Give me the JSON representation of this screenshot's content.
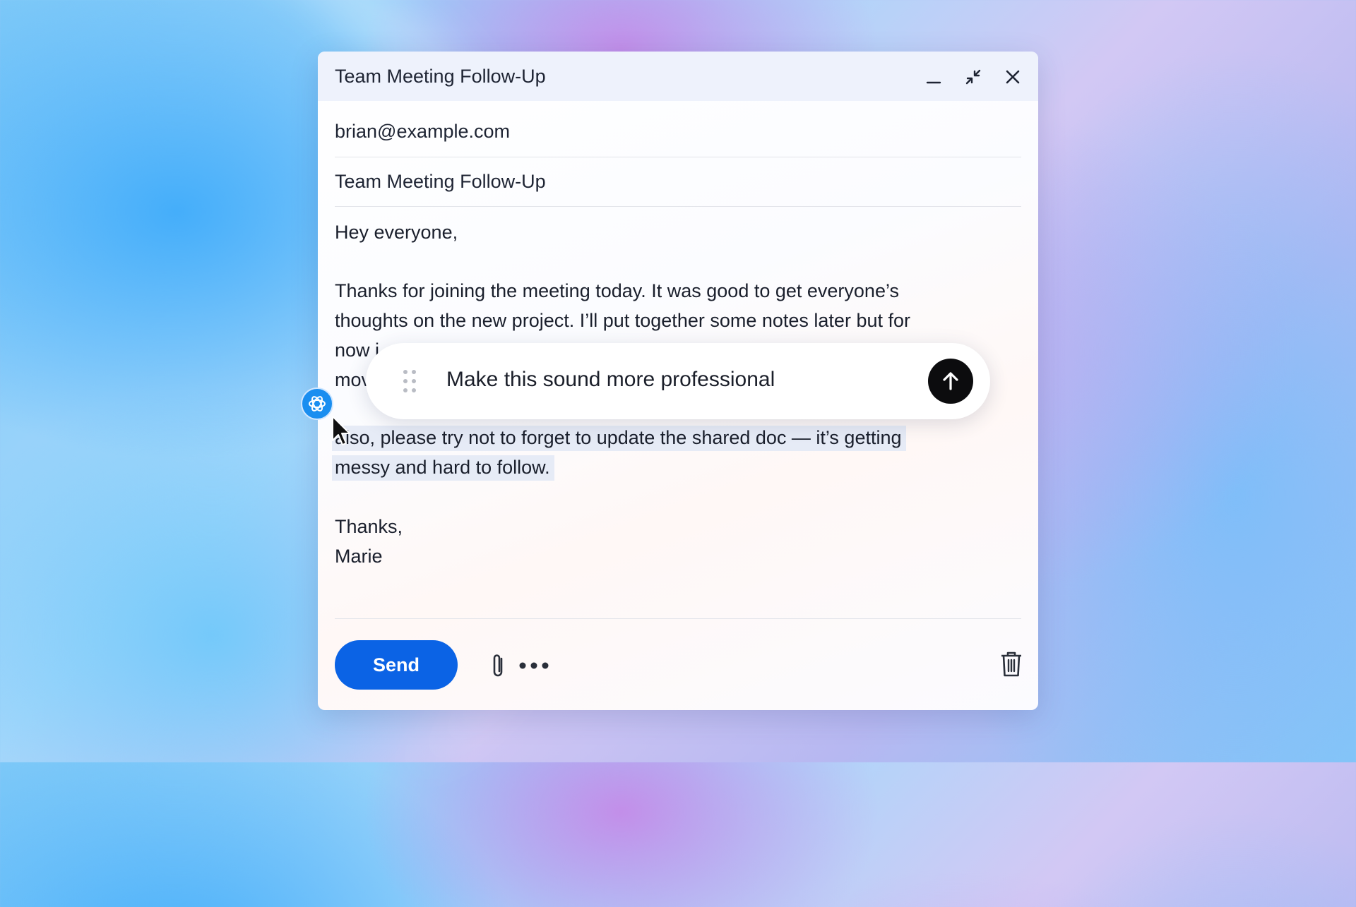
{
  "window": {
    "title": "Team Meeting Follow-Up",
    "controls": [
      "minimize-icon",
      "collapse-icon",
      "close-icon"
    ]
  },
  "compose": {
    "to": "brian@example.com",
    "subject": "Team Meeting Follow-Up",
    "greeting": "Hey everyone,",
    "paragraph1_lines": [
      "Thanks for joining the meeting today. It was good to get everyone’s",
      "thoughts on the new project. I’ll put together some notes later but for",
      "now i",
      "mov"
    ],
    "paragraph2_lines": [
      "also, please try not to forget to update the shared doc — it’s getting",
      "messy and hard to follow."
    ],
    "signoff": "Thanks,",
    "signature": "Marie"
  },
  "prompt_bar": {
    "text": "Make this sound more professional",
    "submit_icon": "arrow-up-icon",
    "handle_icon": "drag-handle-icon"
  },
  "toolbar": {
    "send_label": "Send",
    "attach_icon": "paperclip-icon",
    "more_icon": "more-dots-icon",
    "trash_icon": "trash-icon"
  },
  "overlay": {
    "assistant_icon": "chatgpt-icon",
    "cursor_icon": "mouse-pointer-icon"
  },
  "colors": {
    "send": "#0b63e5",
    "highlight": "#e6ebf6",
    "submit": "#0c0c0e",
    "assistant_badge": "#1a8ef0"
  }
}
